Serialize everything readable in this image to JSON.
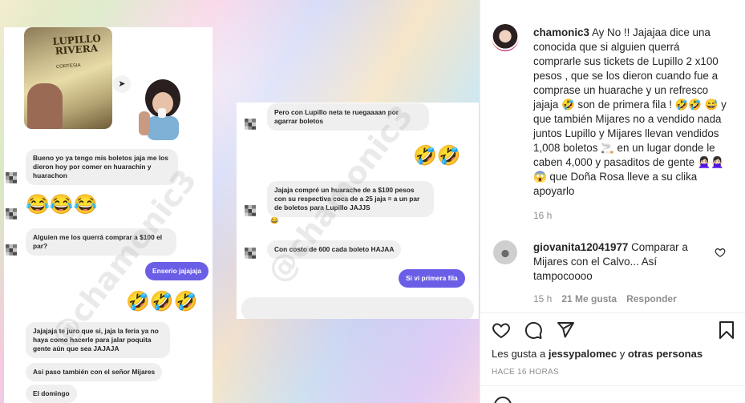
{
  "left_chat": {
    "ticket_title": "LUPILLO RIVERA",
    "ticket_sub": "CORTESIA",
    "messages": [
      {
        "text": "Bueno yo ya tengo mis boletos jaja me los dieron hoy por comer en huarachin y huarachon",
        "me": false
      },
      {
        "text": "Alguien me los querrá comprar a $100 el par?",
        "me": false
      },
      {
        "text": "Enserio jajajaja",
        "me": true
      },
      {
        "text": "Jajajaja te juro que si, jaja la feria ya no haya como hacerle para jalar poquita gente aún que sea JAJAJA",
        "me": false
      },
      {
        "text": "Así paso también con el señor Mijares",
        "me": false
      },
      {
        "text": "El domingo",
        "me": false
      }
    ],
    "emoji_row_1": "😂😂😂",
    "emoji_row_2": "🤣🤣🤣"
  },
  "right_chat": {
    "messages": [
      {
        "text": "Pero con Lupillo neta te ruegaaaan por agarrar boletos",
        "me": false
      },
      {
        "text": "Jajaja compré un huarache de a $100 pesos con su respectiva coca de a 25 jaja = a un par de boletos para Lupillo JAJJS",
        "me": false
      },
      {
        "text": "😂",
        "me": false
      },
      {
        "text": "Con costo de 600 cada boleto HAJAA",
        "me": false
      },
      {
        "text": "Si vi primera fila",
        "me": true
      }
    ],
    "emoji_row": "🤣🤣"
  },
  "watermark": "@chamonic3",
  "caption": {
    "username": "chamonic3",
    "text": "Ay No !! Jajajaa dice una conocida que si alguien querrá comprarle sus tickets de Lupillo 2 x100 pesos , que se los dieron cuando fue a comprase un huarache y un refresco jajaja 🤣 son de primera fila ! 🤣🤣 😅 y que también Mijares no a vendido nada juntos Lupillo y Mijares llevan vendidos 1,008 boletos 🚬 en un lugar donde le caben 4,000 y pasaditos de gente 🙅🏻‍♀️🙅🏻‍♀️😱 que Doña Rosa lleve a su clika apoyarlo",
    "time": "16 h"
  },
  "comment": {
    "username": "giovanita12041977",
    "text": "Comparar a Mijares con el Calvo... Así tampocoooo",
    "time": "15 h",
    "likes": "21 Me gusta",
    "reply": "Responder"
  },
  "likes_line": {
    "prefix": "Les gusta a ",
    "user": "jessypalomec",
    "middle": " y ",
    "others": "otras personas"
  },
  "date": "HACE 16 HORAS",
  "icons": [
    "heart-icon",
    "comment-icon",
    "share-icon",
    "bookmark-icon",
    "like-comment-icon"
  ]
}
